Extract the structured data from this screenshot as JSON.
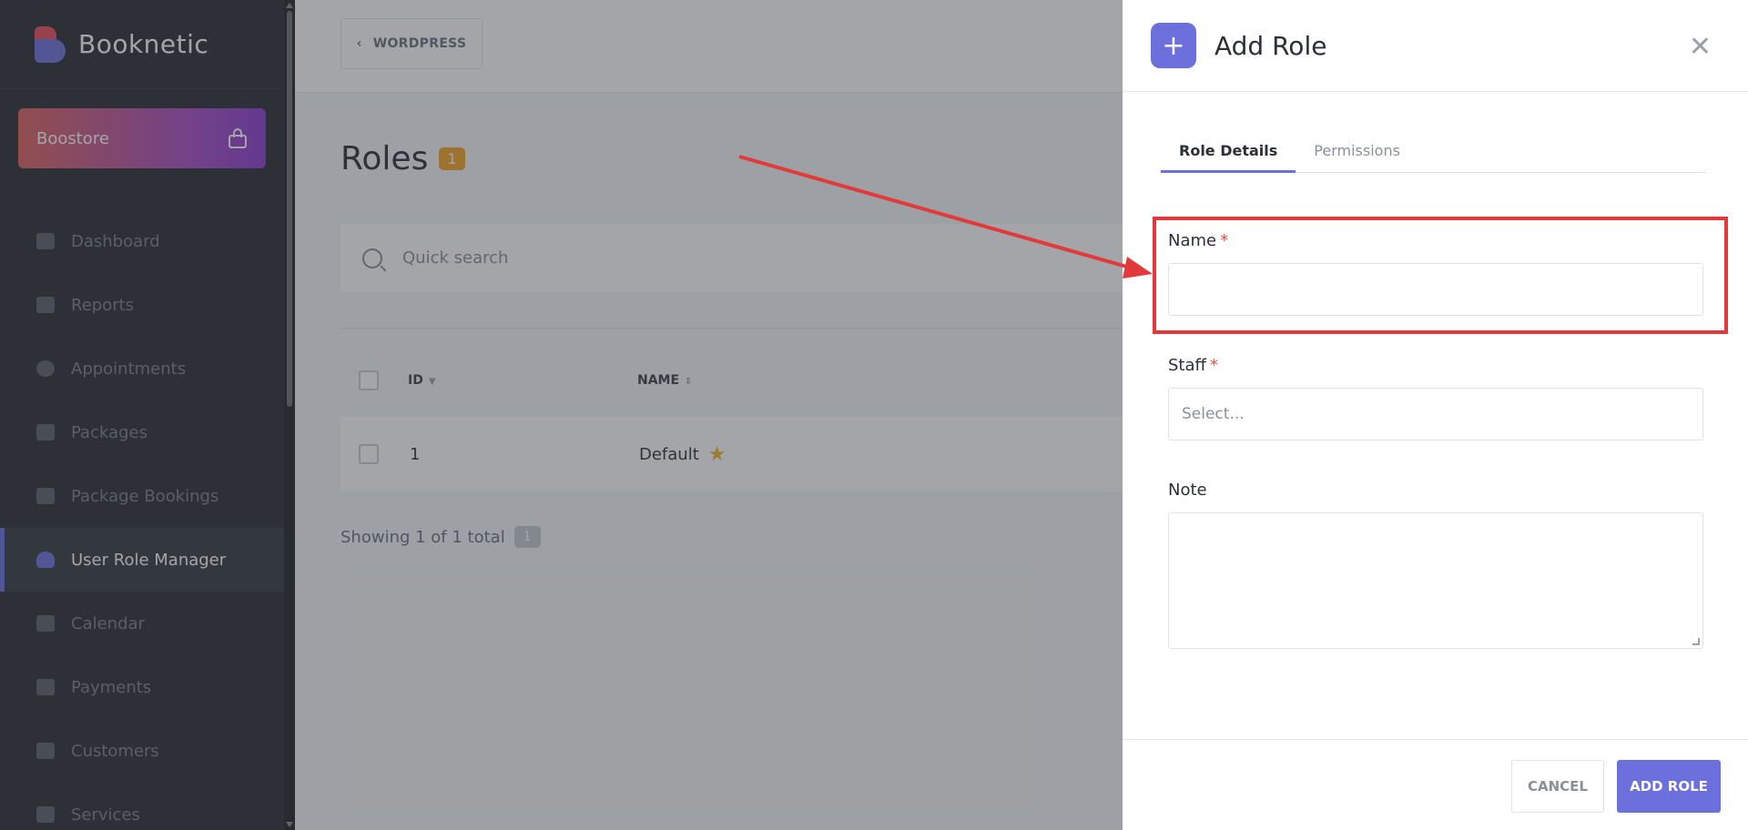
{
  "app": {
    "name": "Booknetic"
  },
  "sidebar": {
    "boostore_label": "Boostore",
    "items": [
      {
        "label": "Dashboard",
        "icon": "cube-icon"
      },
      {
        "label": "Reports",
        "icon": "chart-icon"
      },
      {
        "label": "Appointments",
        "icon": "clock-icon"
      },
      {
        "label": "Packages",
        "icon": "boxes-icon"
      },
      {
        "label": "Package Bookings",
        "icon": "package-icon"
      },
      {
        "label": "User Role Manager",
        "icon": "user-plus-icon",
        "active": true
      },
      {
        "label": "Calendar",
        "icon": "calendar-icon"
      },
      {
        "label": "Payments",
        "icon": "wallet-icon"
      },
      {
        "label": "Customers",
        "icon": "users-icon"
      },
      {
        "label": "Services",
        "icon": "list-icon"
      }
    ]
  },
  "header": {
    "back_label": "WORDPRESS"
  },
  "main": {
    "title": "Roles",
    "count": "1",
    "search_placeholder": "Quick search",
    "columns": {
      "id": "ID",
      "name": "NAME"
    },
    "rows": [
      {
        "id": "1",
        "name": "Default"
      }
    ],
    "footer_text": "Showing 1 of 1 total",
    "footer_count": "1"
  },
  "drawer": {
    "title": "Add Role",
    "tabs": [
      "Role Details",
      "Permissions"
    ],
    "name_label": "Name",
    "staff_label": "Staff",
    "staff_placeholder": "Select...",
    "note_label": "Note",
    "required_mark": "*",
    "cancel_label": "CANCEL",
    "submit_label": "ADD ROLE"
  },
  "colors": {
    "accent": "#6c70dc",
    "annotation": "#e23a3a",
    "badge": "#f5a623"
  }
}
